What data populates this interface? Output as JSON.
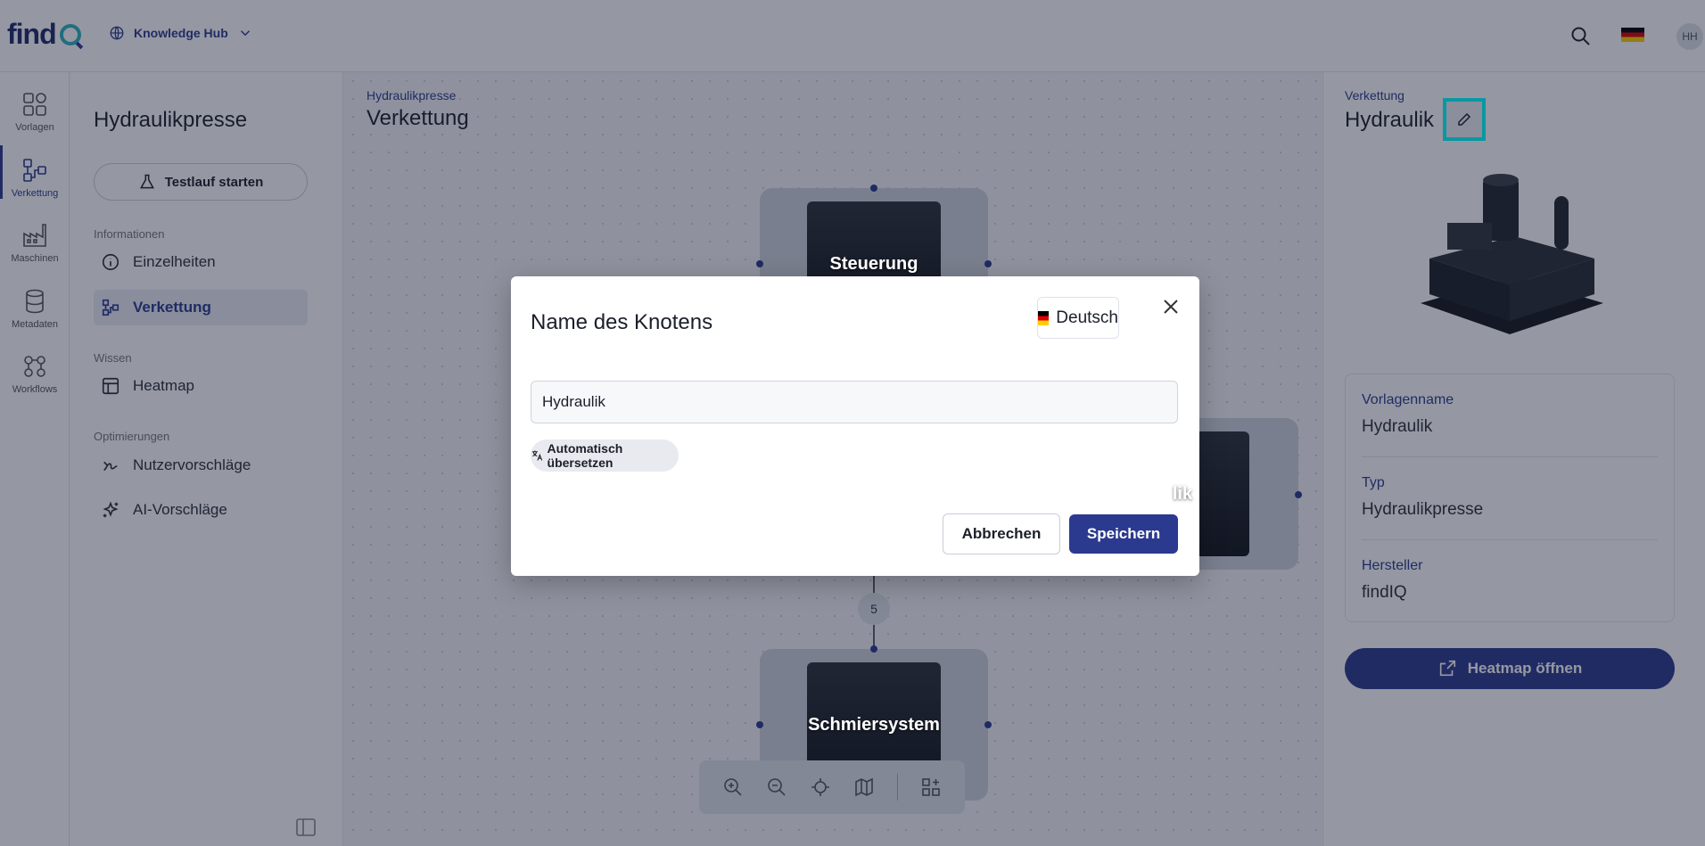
{
  "header": {
    "hub_label": "Knowledge Hub",
    "avatar_initials": "HH"
  },
  "rail": [
    {
      "label": "Vorlagen",
      "icon": "templates-icon"
    },
    {
      "label": "Verkettung",
      "icon": "chain-icon",
      "active": true
    },
    {
      "label": "Maschinen",
      "icon": "factory-icon"
    },
    {
      "label": "Metadaten",
      "icon": "database-icon"
    },
    {
      "label": "Workflows",
      "icon": "workflow-icon"
    }
  ],
  "sidebar": {
    "title": "Hydraulikpresse",
    "test_button": "Testlauf starten",
    "sections": {
      "info": "Informationen",
      "wissen": "Wissen",
      "opt": "Optimierungen"
    },
    "items": {
      "einzelheiten": "Einzelheiten",
      "verkettung": "Verkettung",
      "heatmap": "Heatmap",
      "nutzer": "Nutzervorschläge",
      "ai": "AI-Vorschläge"
    }
  },
  "canvas": {
    "breadcrumb": "Hydraulikpresse",
    "title": "Verkettung",
    "nodes": {
      "steuerung": "Steuerung",
      "hydraulik_partial": "lik",
      "schmier": "Schmiersystem"
    },
    "edge_badge": "5"
  },
  "detail": {
    "breadcrumb": "Verkettung",
    "title": "Hydraulik",
    "fields": {
      "vorlagenname_label": "Vorlagenname",
      "vorlagenname_value": "Hydraulik",
      "typ_label": "Typ",
      "typ_value": "Hydraulikpresse",
      "hersteller_label": "Hersteller",
      "hersteller_value": "findIQ"
    },
    "heatmap_button": "Heatmap öffnen"
  },
  "modal": {
    "title": "Name des Knotens",
    "language": "Deutsch",
    "input_value": "Hydraulik",
    "translate_chip": "Automatisch übersetzen",
    "cancel": "Abbrechen",
    "save": "Speichern"
  },
  "colors": {
    "primary": "#2b3a8f",
    "highlight": "#00ffff",
    "accent": "#2bb3c0"
  }
}
